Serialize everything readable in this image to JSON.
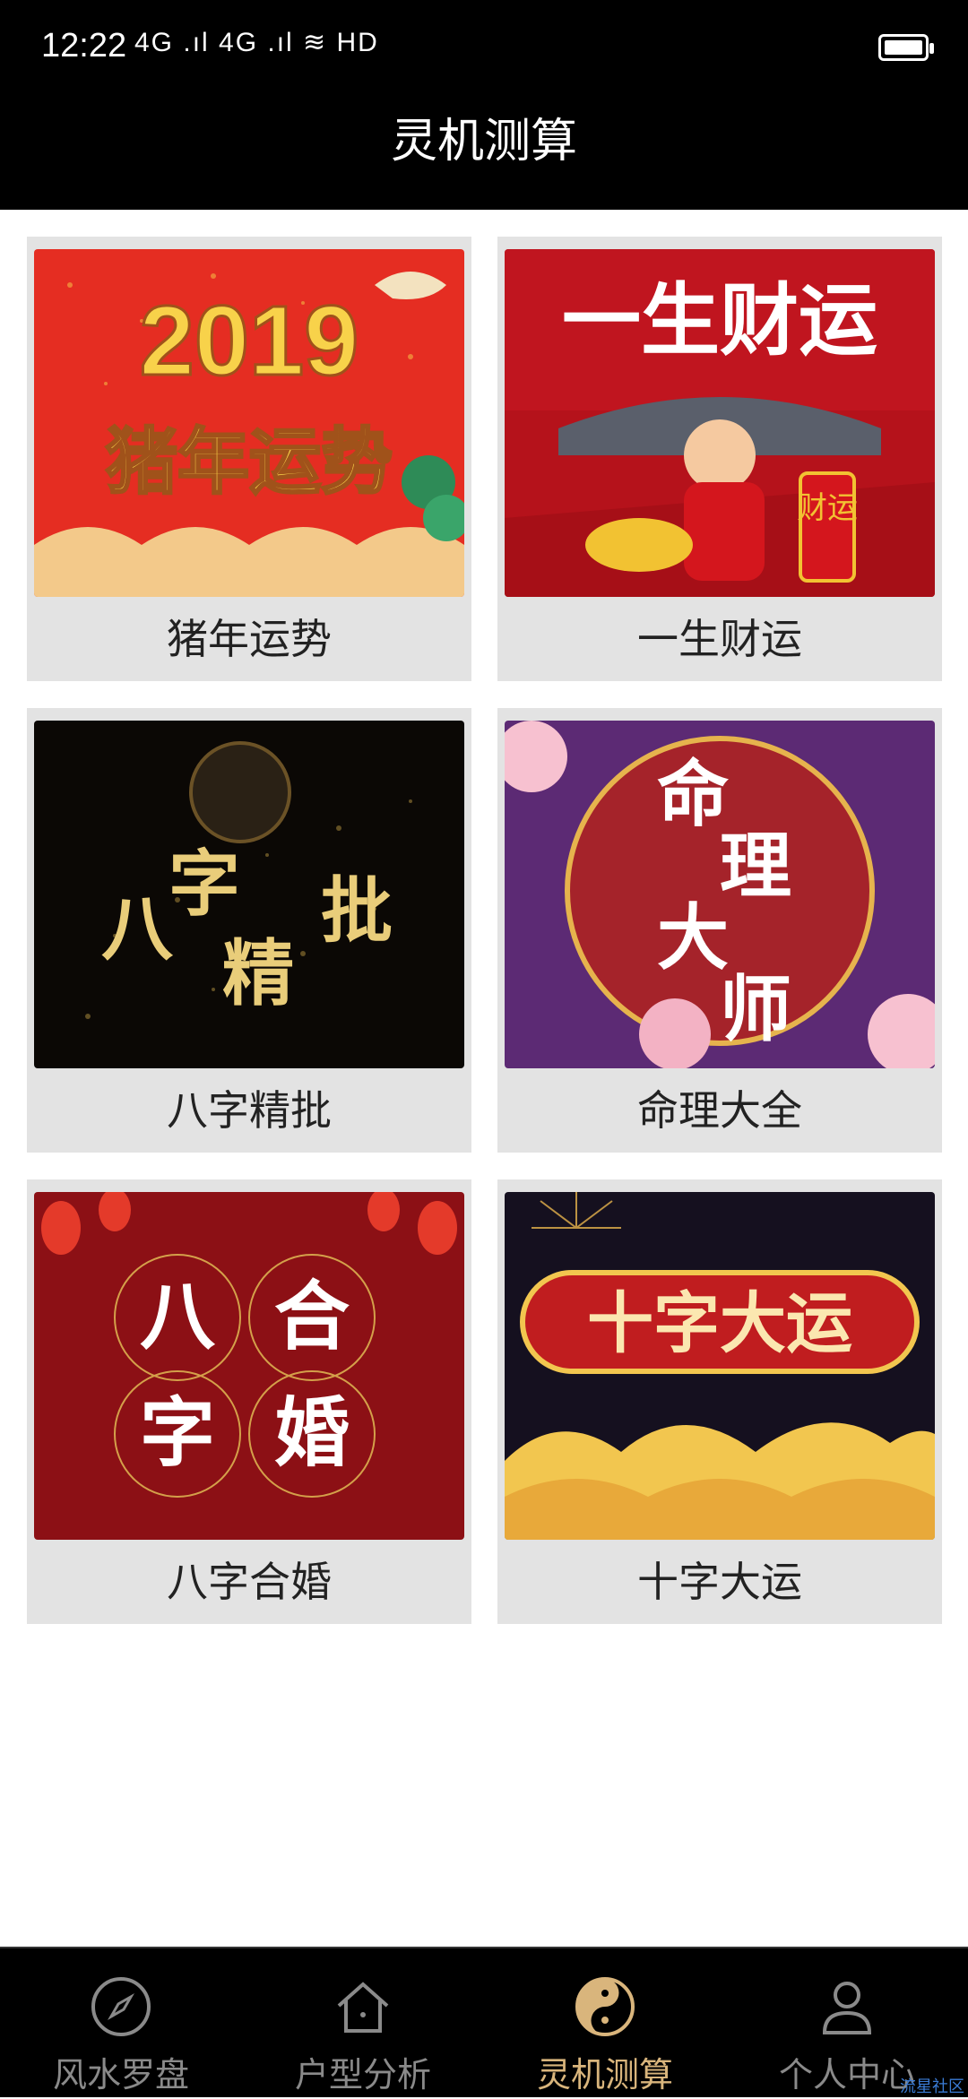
{
  "status": {
    "time": "12:22",
    "signal": "4G .ıl 4G .ıl ≋ HD"
  },
  "header": {
    "title": "灵机测算"
  },
  "cards": [
    {
      "label": "猪年运势",
      "banner_top": "2019",
      "banner_bottom": "猪年运势"
    },
    {
      "label": "一生财运",
      "banner_top": "一生财运",
      "scroll_text": "财运"
    },
    {
      "label": "八字精批",
      "banner_chars": [
        "八",
        "字",
        "精",
        "批"
      ]
    },
    {
      "label": "命理大全",
      "banner_chars": [
        "命",
        "理",
        "大",
        "师"
      ]
    },
    {
      "label": "八字合婚",
      "banner_chars": [
        "八",
        "合",
        "字",
        "婚"
      ]
    },
    {
      "label": "十字大运",
      "banner_top": "十字大运"
    }
  ],
  "nav": [
    {
      "label": "风水罗盘",
      "icon": "compass-icon"
    },
    {
      "label": "户型分析",
      "icon": "house-icon"
    },
    {
      "label": "灵机测算",
      "icon": "yin-yang-icon",
      "active": true
    },
    {
      "label": "个人中心",
      "icon": "person-icon"
    }
  ],
  "colors": {
    "active": "#d9b57c",
    "inactive": "#8a8a8a",
    "card_bg": "#e3e3e3"
  },
  "watermark": "流星社区"
}
